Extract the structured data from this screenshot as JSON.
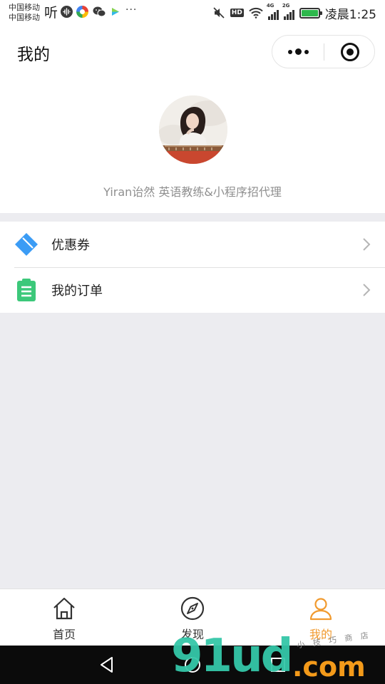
{
  "status_bar": {
    "carrier_1": "中国移动",
    "carrier_2": "中国移动",
    "app_glyph": "听",
    "network_1": "4G",
    "network_2": "2G",
    "hd_badge": "HD",
    "time": "凌晨1:25",
    "battery_color": "#2db84c"
  },
  "header": {
    "title": "我的"
  },
  "profile": {
    "username": "Yiran诒然 英语教练&小程序招代理"
  },
  "menu": {
    "items": [
      {
        "label": "优惠券",
        "icon": "coupon-icon",
        "color": "#3b9cf5"
      },
      {
        "label": "我的订单",
        "icon": "order-clipboard-icon",
        "color": "#3cc87a"
      }
    ]
  },
  "tabbar": {
    "active_color": "#f19a2e",
    "inactive_color": "#333333",
    "tabs": [
      {
        "label": "首页",
        "icon": "home-icon",
        "active": false
      },
      {
        "label": "发现",
        "icon": "compass-icon",
        "active": false
      },
      {
        "label": "我的",
        "icon": "user-icon",
        "active": true
      }
    ]
  },
  "watermark": {
    "main": "91ud",
    "suffix": ".com",
    "small": "小  技  巧  商  店"
  }
}
